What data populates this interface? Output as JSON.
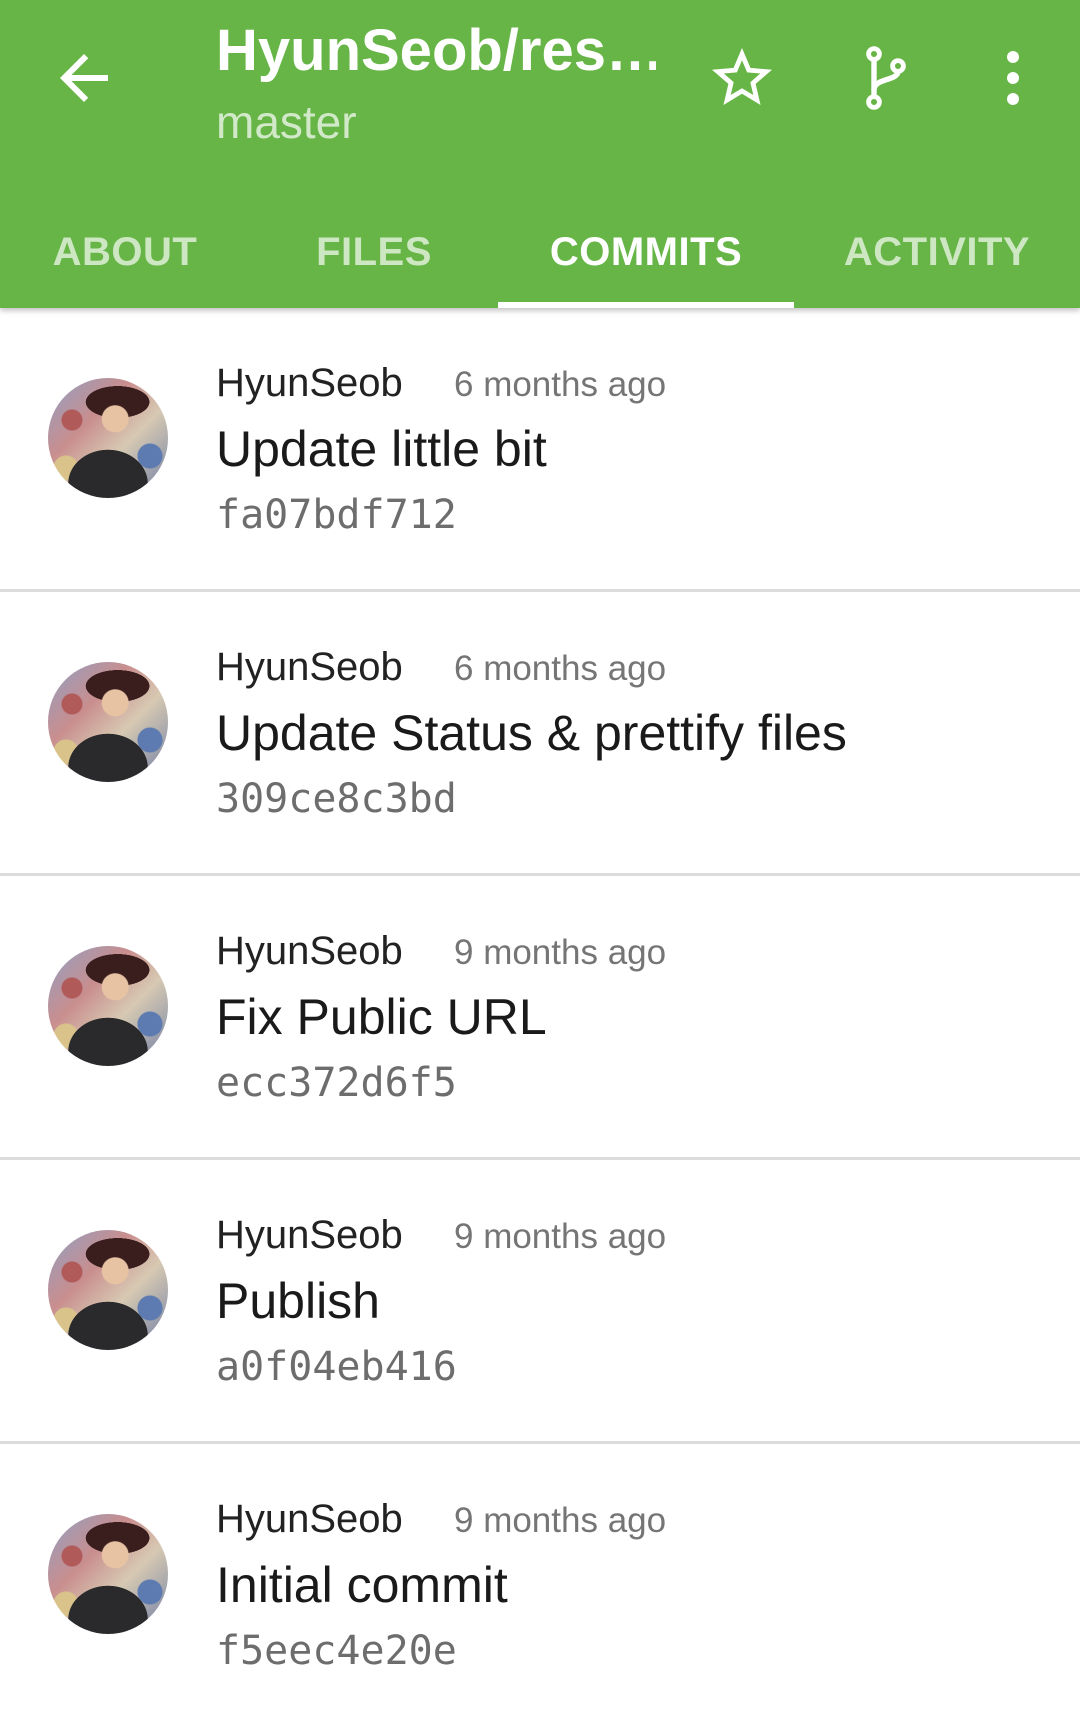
{
  "header": {
    "title": "HyunSeob/res…",
    "subtitle": "master",
    "icons": {
      "back": "arrow-back-icon",
      "star": "star-outline-icon",
      "fork": "branch-icon",
      "more": "more-vert-icon"
    },
    "accent_color": "#66b546"
  },
  "tabs": [
    {
      "label": "ABOUT",
      "active": false
    },
    {
      "label": "FILES",
      "active": false
    },
    {
      "label": "COMMITS",
      "active": true
    },
    {
      "label": "ACTIVITY",
      "active": false
    }
  ],
  "commits": [
    {
      "author": "HyunSeob",
      "time": "6 months ago",
      "message": "Update little bit",
      "sha": "fa07bdf712"
    },
    {
      "author": "HyunSeob",
      "time": "6 months ago",
      "message": "Update Status & prettify files",
      "sha": "309ce8c3bd"
    },
    {
      "author": "HyunSeob",
      "time": "9 months ago",
      "message": "Fix Public URL",
      "sha": "ecc372d6f5"
    },
    {
      "author": "HyunSeob",
      "time": "9 months ago",
      "message": "Publish",
      "sha": "a0f04eb416"
    },
    {
      "author": "HyunSeob",
      "time": "9 months ago",
      "message": "Initial commit",
      "sha": "f5eec4e20e"
    }
  ]
}
